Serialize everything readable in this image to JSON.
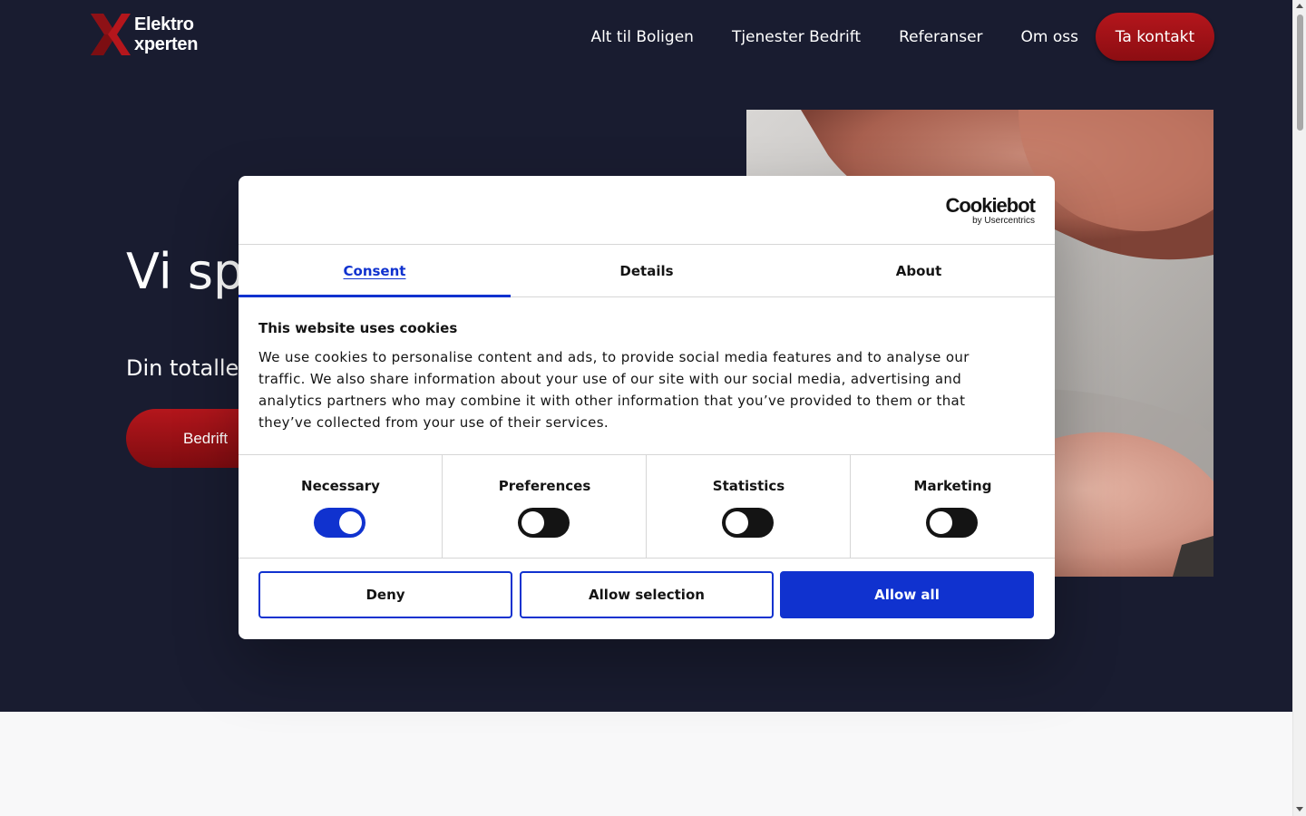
{
  "site": {
    "logo_line1": "Elektro",
    "logo_line2": "xperten",
    "nav": [
      "Alt til Boligen",
      "Tjenester Bedrift",
      "Referanser",
      "Om oss"
    ],
    "cta": "Ta kontakt"
  },
  "hero": {
    "title_visible": "Vi sp",
    "subtitle_visible": "Din totalle",
    "button_visible": "Bedrift"
  },
  "cookie_dialog": {
    "brand": "Cookiebot",
    "brand_sub": "by Usercentrics",
    "tabs": [
      "Consent",
      "Details",
      "About"
    ],
    "active_tab": "Consent",
    "heading": "This website uses cookies",
    "body": "We use cookies to personalise content and ads, to provide social media features and to analyse our traffic. We also share information about your use of our site with our social media, advertising and analytics partners who may combine it with other information that you’ve provided to them or that they’ve collected from your use of their services.",
    "categories": [
      {
        "label": "Necessary",
        "enabled": true
      },
      {
        "label": "Preferences",
        "enabled": false
      },
      {
        "label": "Statistics",
        "enabled": false
      },
      {
        "label": "Marketing",
        "enabled": false
      }
    ],
    "buttons": {
      "deny": "Deny",
      "allow_selection": "Allow selection",
      "allow_all": "Allow all"
    }
  },
  "colors": {
    "hero_bg": "#191c30",
    "brand_red": "#b4161c",
    "cookiebot_blue": "#1032cf"
  }
}
